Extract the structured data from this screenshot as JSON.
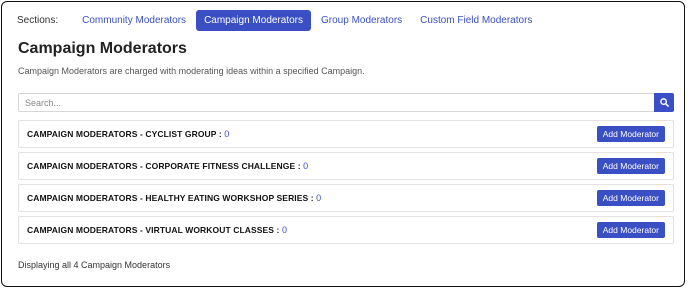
{
  "sections": {
    "label": "Sections:",
    "tabs": [
      {
        "label": "Community Moderators",
        "active": false
      },
      {
        "label": "Campaign Moderators",
        "active": true
      },
      {
        "label": "Group Moderators",
        "active": false
      },
      {
        "label": "Custom Field Moderators",
        "active": false
      }
    ]
  },
  "page": {
    "title": "Campaign Moderators",
    "description": "Campaign Moderators are charged with moderating ideas within a specified Campaign."
  },
  "search": {
    "placeholder": "Search...",
    "value": "",
    "icon": "search-icon"
  },
  "moderator_groups": [
    {
      "title": "CAMPAIGN MODERATORS - CYCLIST GROUP :",
      "count": "0",
      "button_label": "Add Moderator"
    },
    {
      "title": "CAMPAIGN MODERATORS - CORPORATE FITNESS CHALLENGE :",
      "count": "0",
      "button_label": "Add Moderator"
    },
    {
      "title": "CAMPAIGN MODERATORS - HEALTHY EATING WORKSHOP SERIES :",
      "count": "0",
      "button_label": "Add Moderator"
    },
    {
      "title": "CAMPAIGN MODERATORS - VIRTUAL WORKOUT CLASSES :",
      "count": "0",
      "button_label": "Add Moderator"
    }
  ],
  "footer": {
    "text": "Displaying all 4 Campaign Moderators"
  },
  "colors": {
    "accent": "#3a4fc4",
    "text": "#222222",
    "border": "#e2e2e2"
  }
}
